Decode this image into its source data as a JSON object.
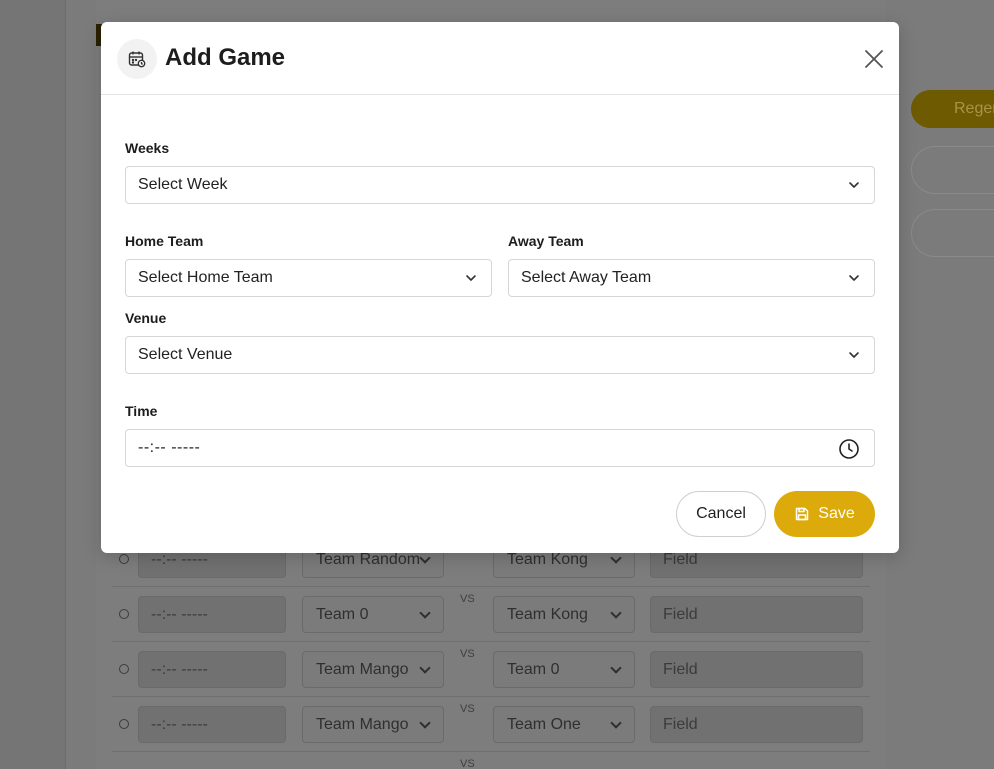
{
  "background": {
    "regenerate_label": "Regenerate",
    "vs_label": "VS",
    "rows": [
      {
        "time": "--:-- -----",
        "home": "Team Random",
        "away": "Team Kong",
        "field": "Field"
      },
      {
        "time": "--:-- -----",
        "home": "Team 0",
        "away": "Team Kong",
        "field": "Field"
      },
      {
        "time": "--:-- -----",
        "home": "Team Mango",
        "away": "Team 0",
        "field": "Field"
      },
      {
        "time": "--:-- -----",
        "home": "Team Mango",
        "away": "Team One",
        "field": "Field"
      }
    ]
  },
  "modal": {
    "title": "Add Game",
    "title_icon": "calendar-clock-icon",
    "weeks": {
      "label": "Weeks",
      "value": "Select Week"
    },
    "home_team": {
      "label": "Home Team",
      "value": "Select Home Team"
    },
    "away_team": {
      "label": "Away Team",
      "value": "Select Away Team"
    },
    "venue": {
      "label": "Venue",
      "value": "Select Venue"
    },
    "time": {
      "label": "Time",
      "value": "--:-- -----"
    },
    "cancel_label": "Cancel",
    "save_label": "Save"
  },
  "colors": {
    "accent": "#dcaa0a",
    "overlay": "#7b7b7b"
  }
}
